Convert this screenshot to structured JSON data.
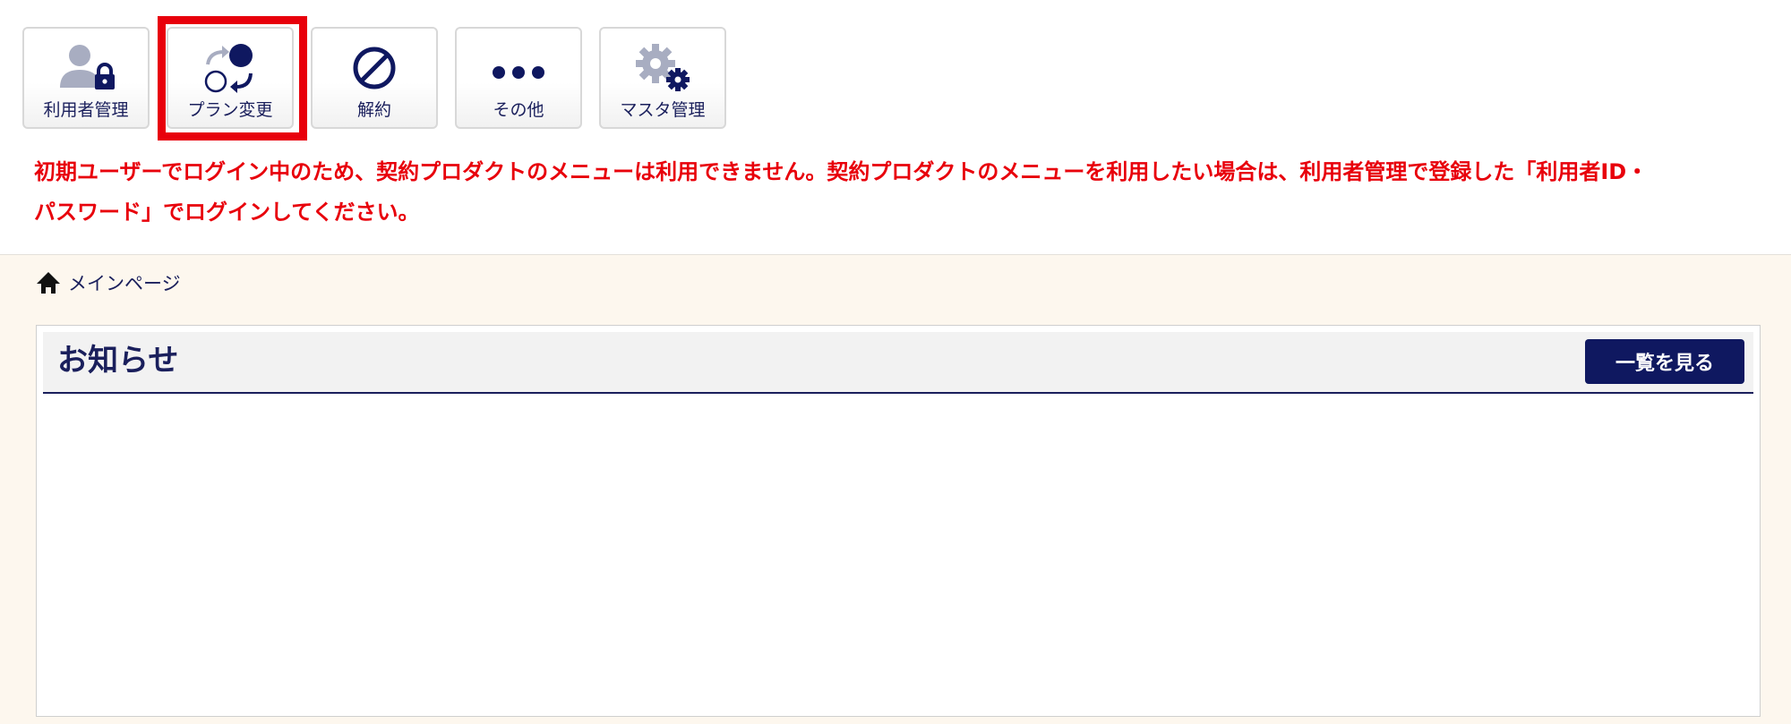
{
  "toolbar": {
    "buttons": [
      {
        "label": "利用者管理",
        "icon": "user-lock-icon"
      },
      {
        "label": "プラン変更",
        "icon": "plan-change-icon",
        "highlighted": true
      },
      {
        "label": "解約",
        "icon": "prohibited-icon"
      },
      {
        "label": "その他",
        "icon": "more-dots-icon"
      },
      {
        "label": "マスタ管理",
        "icon": "gears-icon"
      }
    ]
  },
  "warning": {
    "line1": "初期ユーザーでログイン中のため、契約プロダクトのメニューは利用できません。契約プロダクトのメニューを利用したい場合は、利用者管理で登録した「利用者ID・",
    "line2": "パスワード」でログインしてください。"
  },
  "breadcrumb": {
    "icon": "home-icon",
    "label": "メインページ"
  },
  "notice": {
    "title": "お知らせ",
    "view_all_label": "一覧を見る"
  },
  "colors": {
    "accent_navy": "#1a1f5c",
    "button_navy": "#0f1860",
    "warning_red": "#e8000b",
    "highlight_red": "#e8000b",
    "page_background": "#fdf7ee",
    "icon_gray": "#a8adc1"
  }
}
